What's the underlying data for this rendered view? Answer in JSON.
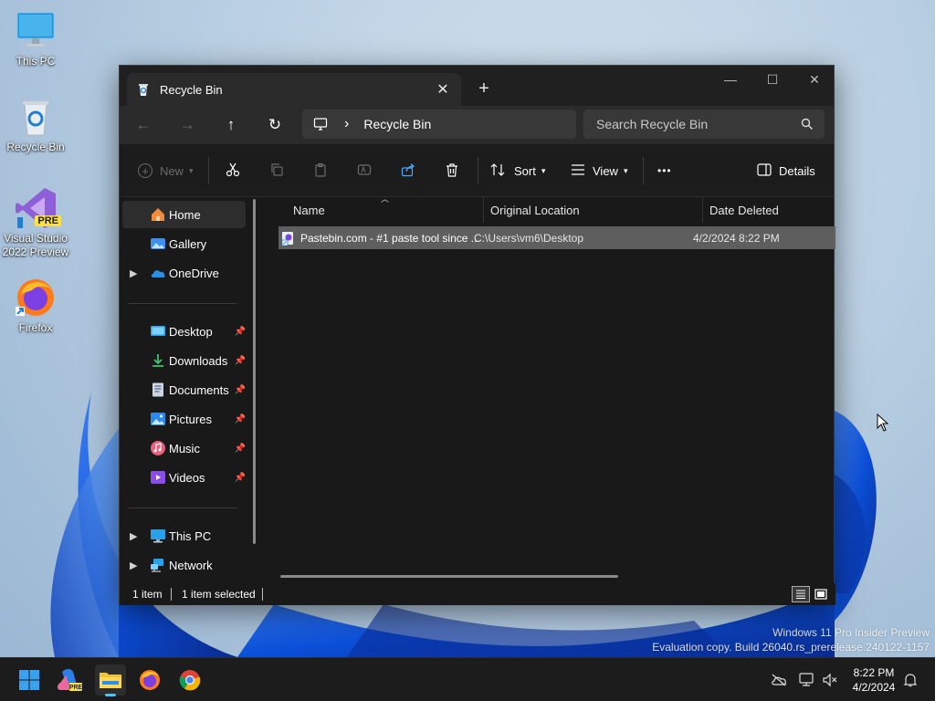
{
  "desktop": {
    "icons": [
      {
        "label": "This PC"
      },
      {
        "label": "Recycle Bin"
      },
      {
        "label": "Visual Studio 2022 Preview",
        "badge": "PRE"
      },
      {
        "label": "Firefox"
      }
    ],
    "watermark": {
      "line1": "Windows 11 Pro Insider Preview",
      "line2": "Evaluation copy. Build 26040.rs_prerelease.240122-1157"
    }
  },
  "window": {
    "tab_title": "Recycle Bin",
    "tab_icon": "recycle-bin-icon",
    "controls": {
      "minimize": "—",
      "maximize": "☐",
      "close": "✕"
    },
    "nav": {
      "back": "←",
      "forward": "→",
      "up": "↑",
      "refresh": "↻"
    },
    "address": {
      "separator": "›",
      "location": "Recycle Bin"
    },
    "search": {
      "placeholder": "Search Recycle Bin"
    },
    "toolbar": {
      "new_label": "New",
      "sort_label": "Sort",
      "view_label": "View",
      "more_label": "•••",
      "details_label": "Details"
    },
    "sidebar": {
      "items": [
        {
          "label": "Home",
          "icon": "home-icon",
          "selected": true
        },
        {
          "label": "Gallery",
          "icon": "gallery-icon"
        },
        {
          "label": "OneDrive",
          "icon": "onedrive-icon",
          "expandable": true
        },
        {
          "label": "Desktop",
          "icon": "desktop-folder-icon",
          "pinned": true
        },
        {
          "label": "Downloads",
          "icon": "downloads-icon",
          "pinned": true
        },
        {
          "label": "Documents",
          "icon": "documents-icon",
          "pinned": true
        },
        {
          "label": "Pictures",
          "icon": "pictures-icon",
          "pinned": true
        },
        {
          "label": "Music",
          "icon": "music-icon",
          "pinned": true
        },
        {
          "label": "Videos",
          "icon": "videos-icon",
          "pinned": true
        },
        {
          "label": "This PC",
          "icon": "this-pc-icon",
          "expandable": true
        },
        {
          "label": "Network",
          "icon": "network-icon",
          "expandable": true
        }
      ]
    },
    "columns": [
      "Name",
      "Original Location",
      "Date Deleted"
    ],
    "rows": [
      {
        "name": "Pastebin.com - #1 paste tool since ...",
        "original_location": "C:\\Users\\vm6\\Desktop",
        "date_deleted": "4/2/2024 8:22 PM"
      }
    ],
    "status": {
      "count": "1 item",
      "selected": "1 item selected"
    }
  },
  "taskbar": {
    "apps": [
      "start-icon",
      "copilot-icon",
      "file-explorer-icon",
      "firefox-icon",
      "chrome-icon"
    ],
    "time": "8:22 PM",
    "date": "4/2/2024"
  },
  "colors": {
    "window_bg": "#191919",
    "selected_row": "#5e5e5e",
    "accent": "#0078d4"
  }
}
